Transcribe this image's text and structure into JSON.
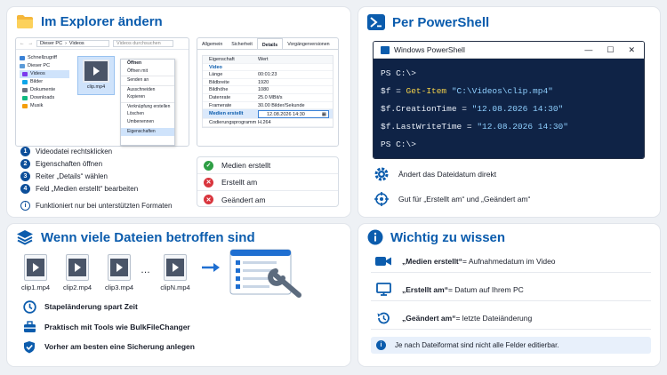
{
  "explorer_panel": {
    "title": "Im Explorer ändern",
    "address": {
      "path1": "Dieser PC",
      "path2": "Videos",
      "search_placeholder": "Videos durchsuchen"
    },
    "tree": [
      "Schnellzugriff",
      "Dieser PC",
      "Videos",
      "Bilder",
      "Dokumente",
      "Downloads",
      "Musik"
    ],
    "file_name": "clip.mp4",
    "context_menu": [
      "Öffnen",
      "Öffnen mit",
      "Senden an",
      "Ausschneiden",
      "Kopieren",
      "Verknüpfung erstellen",
      "Löschen",
      "Umbenennen",
      "Eigenschaften"
    ],
    "props": {
      "tabs": [
        "Allgemein",
        "Sicherheit",
        "Details",
        "Vorgängerversionen"
      ],
      "header_prop": "Eigenschaft",
      "header_val": "Wert",
      "group": "Video",
      "rows": [
        {
          "k": "Länge",
          "v": "00:01:23"
        },
        {
          "k": "Bildbreite",
          "v": "1920"
        },
        {
          "k": "Bildhöhe",
          "v": "1080"
        },
        {
          "k": "Datenrate",
          "v": "25.0 MBit/s"
        },
        {
          "k": "Framerate",
          "v": "30.00 Bilder/Sekunde"
        }
      ],
      "edit_label": "Medien erstellt",
      "edit_value": "12.08.2026 14:30",
      "codec_label": "Codierungsprogramm",
      "codec_value": "H.264"
    },
    "steps": [
      "Videodatei rechtsklicken",
      "Eigenschaften öffnen",
      "Reiter „Details“ wählen",
      "Feld „Medien erstellt“ bearbeiten"
    ],
    "step_numbers": [
      "1",
      "2",
      "3",
      "4"
    ],
    "note": "Funktioniert nur bei unterstützten Formaten",
    "status": [
      {
        "label": "Medien erstellt",
        "ok": true
      },
      {
        "label": "Erstellt am",
        "ok": false
      },
      {
        "label": "Geändert am",
        "ok": false
      }
    ]
  },
  "powershell_panel": {
    "title": "Per PowerShell",
    "window_title": "Windows PowerShell",
    "prompt": "PS C:\\>",
    "line1_var": "$f",
    "line1_eq": " = ",
    "line1_cmd": "Get-Item",
    "line1_arg": " \"C:\\Videos\\clip.mp4\"",
    "line2_prop": "$f.CreationTime",
    "line2_eq": " = ",
    "line2_val": "\"12.08.2026 14:30\"",
    "line3_prop": "$f.LastWriteTime",
    "line3_eq": " = ",
    "line3_val": "\"12.08.2026 14:30\"",
    "features": [
      "Ändert das Dateidatum direkt",
      "Gut für „Erstellt am“ und „Geändert am“"
    ]
  },
  "batch_panel": {
    "title": "Wenn viele Dateien betroffen sind",
    "files": [
      "clip1.mp4",
      "clip2.mp4",
      "clip3.mp4",
      "clipN.mp4"
    ],
    "ellipsis": "…",
    "bullets": [
      "Stapeländerung spart Zeit",
      "Praktisch mit Tools wie BulkFileChanger",
      "Vorher am besten eine Sicherung anlegen"
    ]
  },
  "info_panel": {
    "title": "Wichtig zu wissen",
    "rows": [
      {
        "term": "„Medien erstellt“",
        "desc": " = Aufnahmedatum im Video"
      },
      {
        "term": "„Erstellt am“",
        "desc": " = Datum auf Ihrem PC"
      },
      {
        "term": "„Geändert am“",
        "desc": " = letzte Dateiänderung"
      }
    ],
    "note": "Je nach Dateiformat sind nicht alle Felder editierbar."
  },
  "colors": {
    "accent": "#0b5cad",
    "ok": "#2e9e44",
    "bad": "#d9363e",
    "ps_bg": "#0f2346"
  }
}
